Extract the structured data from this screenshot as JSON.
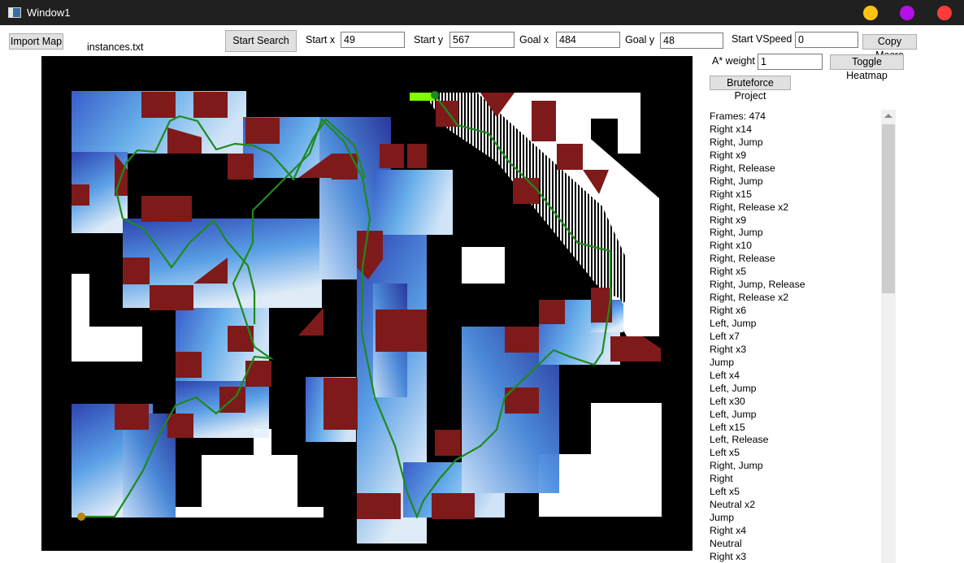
{
  "window": {
    "title": "Window1",
    "buttons": {
      "minimize_color": "#ffc30f",
      "maximize_color": "#b40fe6",
      "close_color": "#ff3b3b"
    }
  },
  "toolbar": {
    "import_label": "Import Map",
    "file_name": "instances.txt",
    "start_search_label": "Start Search",
    "start_x_label": "Start x",
    "start_x": "49",
    "start_y_label": "Start y",
    "start_y": "567",
    "goal_x_label": "Goal x",
    "goal_x": "484",
    "goal_y_label": "Goal y",
    "goal_y": "48",
    "start_vspeed_label": "Start VSpeed",
    "start_vspeed": "0",
    "copy_macro_label": "Copy Macro",
    "astar_weight_label": "A* weight",
    "astar_weight": "1",
    "toggle_heatmap_label": "Toggle Heatmap",
    "bruteforce_label": "Bruteforce Project"
  },
  "map": {
    "colors": {
      "wall": "#000000",
      "open": "#ffffff",
      "hazard": "#7f1a1a",
      "path": "#1e8a1e",
      "goal_marker": "#7fff00",
      "start_marker": "#b8860b",
      "heat_light": "#e8f4ff",
      "heat_mid": "#5aa0f0",
      "heat_dark": "#2a3aa0"
    }
  },
  "log": {
    "items": [
      "Frames: 474",
      "Right x14",
      "Right, Jump",
      "Right x9",
      "Right, Release",
      "Right, Jump",
      "Right x15",
      "Right, Release x2",
      "Right x9",
      "Right, Jump",
      "Right x10",
      "Right, Release",
      "Right x5",
      "Right, Jump, Release",
      "Right, Release x2",
      "Right x6",
      "Left, Jump",
      "Left x7",
      "Right x3",
      "Jump",
      "Left x4",
      "Left, Jump",
      "Left x30",
      "Left, Jump",
      "Left x15",
      "Left, Release",
      "Left x5",
      "Right, Jump",
      "Right",
      "Left x5",
      "Neutral x2",
      "Jump",
      "Right x4",
      "Neutral",
      "Right x3"
    ]
  }
}
